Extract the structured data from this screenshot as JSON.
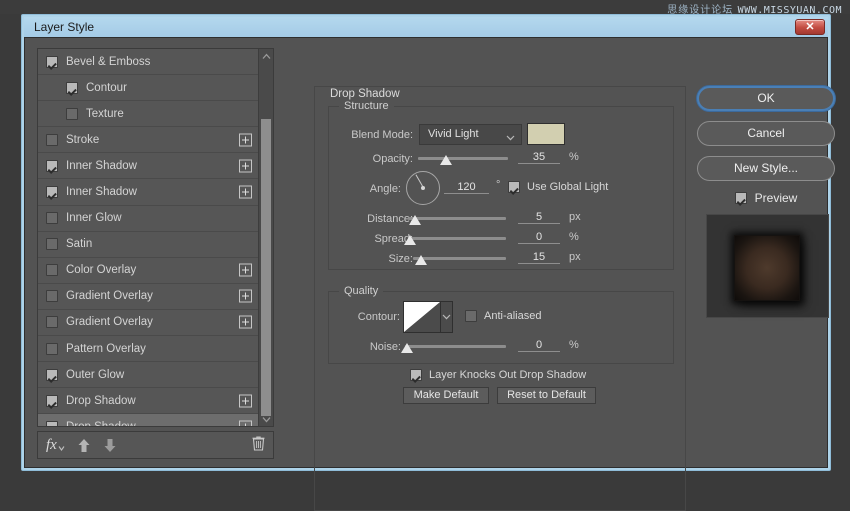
{
  "watermark": {
    "cn": "思缘设计论坛",
    "en": "WWW.MISSYUAN.COM"
  },
  "window": {
    "title": "Layer Style",
    "close_label": "✕"
  },
  "effects_list": {
    "items": [
      {
        "label": "Bevel & Emboss",
        "checked": true,
        "sub": false,
        "plus": false,
        "selected": false,
        "collapse": true
      },
      {
        "label": "Contour",
        "checked": true,
        "sub": true,
        "plus": false,
        "selected": false
      },
      {
        "label": "Texture",
        "checked": false,
        "sub": true,
        "plus": false,
        "selected": false
      },
      {
        "label": "Stroke",
        "checked": false,
        "sub": false,
        "plus": true,
        "selected": false
      },
      {
        "label": "Inner Shadow",
        "checked": true,
        "sub": false,
        "plus": true,
        "selected": false
      },
      {
        "label": "Inner Shadow",
        "checked": true,
        "sub": false,
        "plus": true,
        "selected": false
      },
      {
        "label": "Inner Glow",
        "checked": false,
        "sub": false,
        "plus": false,
        "selected": false
      },
      {
        "label": "Satin",
        "checked": false,
        "sub": false,
        "plus": false,
        "selected": false
      },
      {
        "label": "Color Overlay",
        "checked": false,
        "sub": false,
        "plus": true,
        "selected": false
      },
      {
        "label": "Gradient Overlay",
        "checked": false,
        "sub": false,
        "plus": true,
        "selected": false
      },
      {
        "label": "Gradient Overlay",
        "checked": false,
        "sub": false,
        "plus": true,
        "selected": false
      },
      {
        "label": "Pattern Overlay",
        "checked": false,
        "sub": false,
        "plus": false,
        "selected": false
      },
      {
        "label": "Outer Glow",
        "checked": true,
        "sub": false,
        "plus": false,
        "selected": false
      },
      {
        "label": "Drop Shadow",
        "checked": true,
        "sub": false,
        "plus": true,
        "selected": false
      },
      {
        "label": "Drop Shadow",
        "checked": true,
        "sub": false,
        "plus": true,
        "selected": true
      }
    ],
    "toolbar": {
      "fx_label": "fx",
      "move_up_label": "▲",
      "move_down_label": "▼",
      "delete_label": "Delete effect"
    }
  },
  "settings": {
    "effect_title": "Drop Shadow",
    "structure": {
      "group_title": "Structure",
      "blend_mode_label": "Blend Mode:",
      "blend_mode_value": "Vivid Light",
      "color_swatch": "#d2cfb0",
      "opacity_label": "Opacity:",
      "opacity_value": "35",
      "opacity_unit": "%",
      "angle_label": "Angle:",
      "angle_value": "120",
      "angle_unit": "°",
      "use_global_light_label": "Use Global Light",
      "use_global_light_checked": true,
      "distance_label": "Distance:",
      "distance_value": "5",
      "distance_unit": "px",
      "spread_label": "Spread:",
      "spread_value": "0",
      "spread_unit": "%",
      "size_label": "Size:",
      "size_value": "15",
      "size_unit": "px"
    },
    "quality": {
      "group_title": "Quality",
      "contour_label": "Contour:",
      "anti_aliased_label": "Anti-aliased",
      "anti_aliased_checked": false,
      "noise_label": "Noise:",
      "noise_value": "0",
      "noise_unit": "%"
    },
    "knockout_label": "Layer Knocks Out Drop Shadow",
    "knockout_checked": true,
    "make_default_label": "Make Default",
    "reset_default_label": "Reset to Default"
  },
  "right_panel": {
    "ok_label": "OK",
    "cancel_label": "Cancel",
    "new_style_label": "New Style...",
    "preview_label": "Preview",
    "preview_checked": true
  },
  "colors": {
    "accent_blue": "#aed4ea",
    "panel_bg": "#535353",
    "list_bg": "#565656",
    "selected_row": "#6d6d6d",
    "close_red": "#c24b41"
  }
}
